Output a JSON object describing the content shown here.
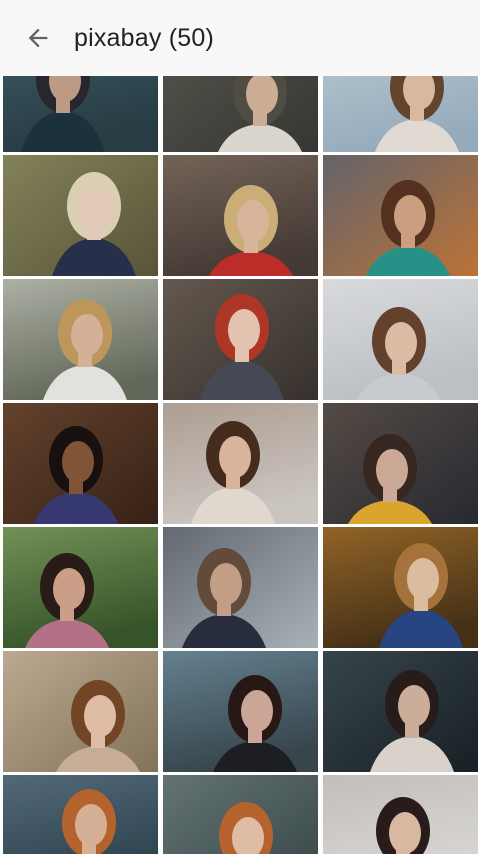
{
  "toolbar": {
    "title": "pixabay (50)",
    "back_icon": "arrow-back-icon"
  },
  "gallery": {
    "columns": 3,
    "items": [
      {
        "name": "photo-1",
        "bg1": "#2a4048",
        "bg2": "#40606a",
        "fg": "#1f3540",
        "skin": "#c9a48c",
        "hair": "#2a2a30"
      },
      {
        "name": "photo-2",
        "bg1": "#3a3a36",
        "bg2": "#5a5a52",
        "fg": "#e8e4dc",
        "skin": "#d8b8a0",
        "hair": "#555048"
      },
      {
        "name": "photo-3",
        "bg1": "#9fb6c8",
        "bg2": "#c6d6e0",
        "fg": "#f0e8e0",
        "skin": "#e8c4a8",
        "hair": "#6a4a30"
      },
      {
        "name": "photo-4",
        "bg1": "#5e5a3c",
        "bg2": "#8c8a60",
        "fg": "#2a3350",
        "skin": "#f0d6c4",
        "hair": "#e8dcc0"
      },
      {
        "name": "photo-5",
        "bg1": "#4a3e38",
        "bg2": "#7a6a5e",
        "fg": "#c8302c",
        "skin": "#e6c0a4",
        "hair": "#d8b880"
      },
      {
        "name": "photo-6",
        "bg1": "#c87a3c",
        "bg2": "#6a6a70",
        "fg": "#2a9a90",
        "skin": "#d8a888",
        "hair": "#5a3420"
      },
      {
        "name": "photo-7",
        "bg1": "#6a7060",
        "bg2": "#b8bcb0",
        "fg": "#f2f0ec",
        "skin": "#e2bca0",
        "hair": "#c8a060"
      },
      {
        "name": "photo-8",
        "bg1": "#3a3430",
        "bg2": "#6a5e54",
        "fg": "#4a4e5a",
        "skin": "#f0d0bc",
        "hair": "#b83a28"
      },
      {
        "name": "photo-9",
        "bg1": "#c8ccd0",
        "bg2": "#e6e8ea",
        "fg": "#d4d8dc",
        "skin": "#e8c8b0",
        "hair": "#6a4630"
      },
      {
        "name": "photo-10",
        "bg1": "#3a2418",
        "bg2": "#6a4630",
        "fg": "#3a3c7a",
        "skin": "#8a5a3c",
        "hair": "#1a1210"
      },
      {
        "name": "photo-11",
        "bg1": "#d8d2cc",
        "bg2": "#b8a89c",
        "fg": "#efe6dc",
        "skin": "#e8c0a4",
        "hair": "#4a3020"
      },
      {
        "name": "photo-12",
        "bg1": "#2a2c36",
        "bg2": "#5a5048",
        "fg": "#e8b030",
        "skin": "#d8b4a0",
        "hair": "#3a2a24"
      },
      {
        "name": "photo-13",
        "bg1": "#3a5a2c",
        "bg2": "#7a9a5c",
        "fg": "#c07890",
        "skin": "#d8a890",
        "hair": "#2a1e1a"
      },
      {
        "name": "photo-14",
        "bg1": "#b4bcc4",
        "bg2": "#6a7078",
        "fg": "#2a3040",
        "skin": "#d0a890",
        "hair": "#6a5040"
      },
      {
        "name": "photo-15",
        "bg1": "#4a3418",
        "bg2": "#9a6a2a",
        "fg": "#2a4a8a",
        "skin": "#e8c8a8",
        "hair": "#b07a40"
      },
      {
        "name": "photo-16",
        "bg1": "#8a7a60",
        "bg2": "#c8b49a",
        "fg": "#d4b8a0",
        "skin": "#ecc8b0",
        "hair": "#7a4a28"
      },
      {
        "name": "photo-17",
        "bg1": "#3c4a52",
        "bg2": "#6a8a98",
        "fg": "#1e2026",
        "skin": "#d8b0a0",
        "hair": "#2a1a18"
      },
      {
        "name": "photo-18",
        "bg1": "#1a2228",
        "bg2": "#3a4a50",
        "fg": "#e6e0d8",
        "skin": "#d8b8a4",
        "hair": "#2a1e1c"
      },
      {
        "name": "photo-19",
        "bg1": "#2e4450",
        "bg2": "#587080",
        "fg": "#e8ecf0",
        "skin": "#e4bca0",
        "hair": "#c06a30"
      },
      {
        "name": "photo-20",
        "bg1": "#3a4a4c",
        "bg2": "#6a7a7a",
        "fg": "#d8d4d0",
        "skin": "#ecc8b0",
        "hair": "#c06a30"
      },
      {
        "name": "photo-21",
        "bg1": "#e8e6e4",
        "bg2": "#cfcac6",
        "fg": "#f4f2f0",
        "skin": "#e6c4ac",
        "hair": "#2a1e1c"
      }
    ]
  }
}
